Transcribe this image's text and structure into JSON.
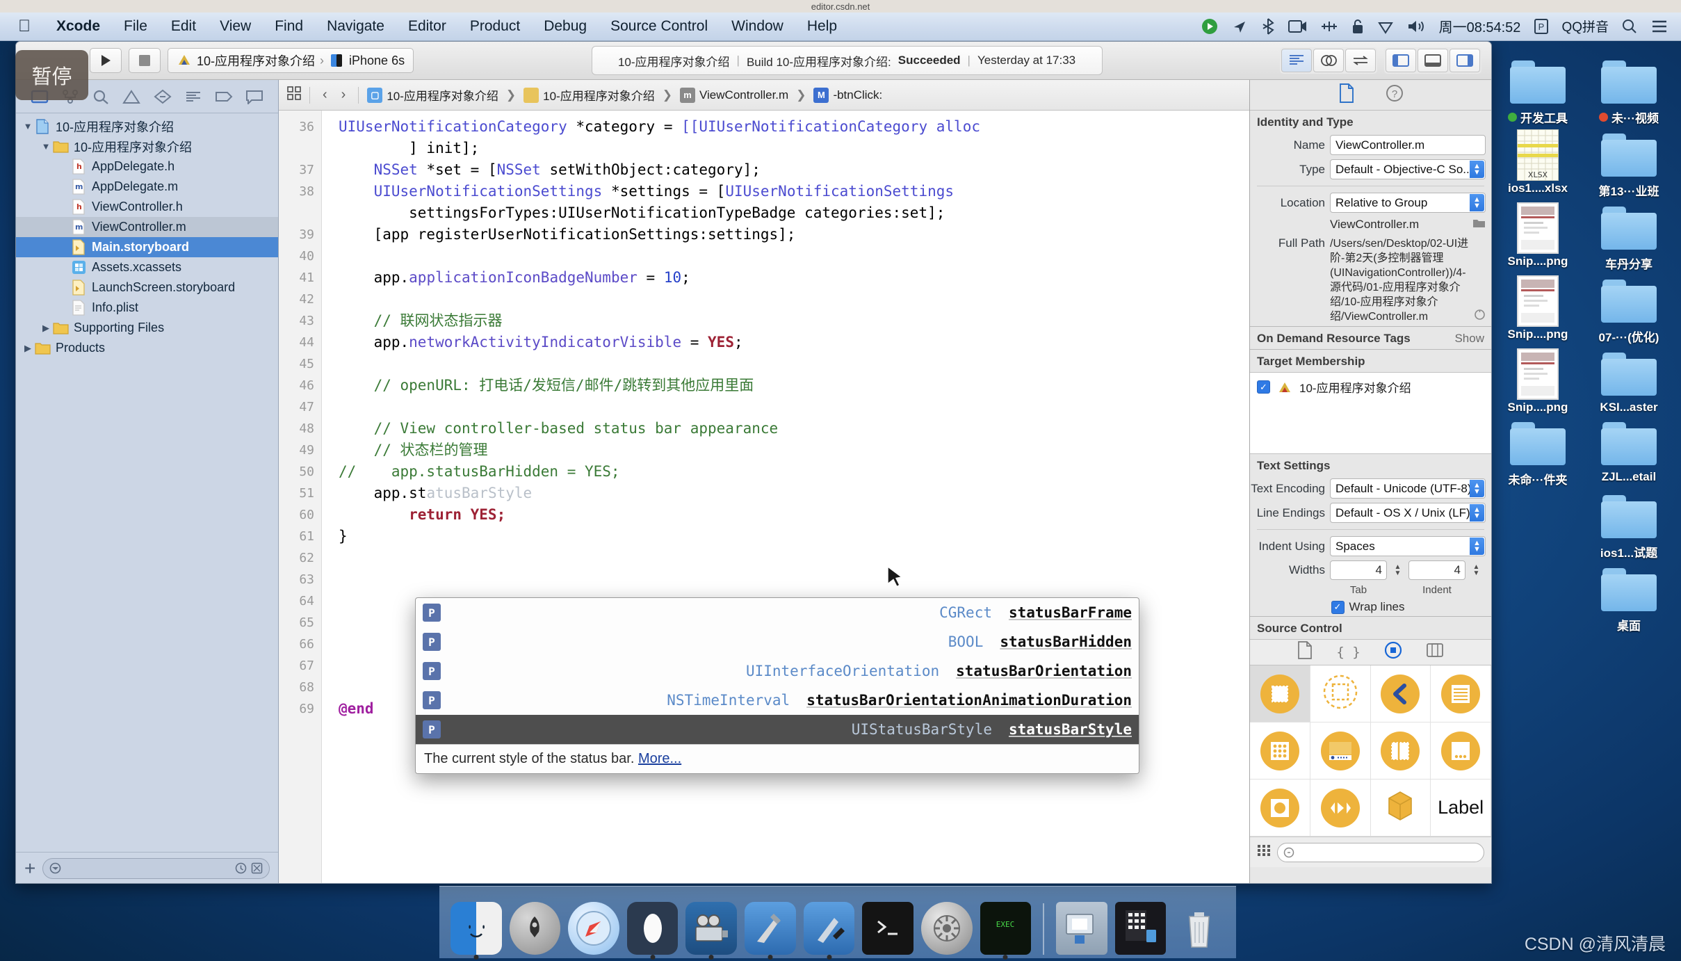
{
  "browser": {
    "url": "editor.csdn.net"
  },
  "menubar": {
    "apple_icon": "apple-logo-icon",
    "items": [
      "Xcode",
      "File",
      "Edit",
      "View",
      "Find",
      "Navigate",
      "Editor",
      "Product",
      "Debug",
      "Source Control",
      "Window",
      "Help"
    ],
    "status_items": [
      {
        "name": "screen-recorder-icon",
        "glyph": "▶"
      },
      {
        "name": "location-arrow-icon",
        "glyph": "➤"
      },
      {
        "name": "bluetooth-icon",
        "glyph": "✛"
      },
      {
        "name": "camera-icon",
        "glyph": "▣"
      },
      {
        "name": "audio-midi-icon",
        "glyph": "⬌"
      },
      {
        "name": "lock-icon",
        "glyph": "🔓"
      },
      {
        "name": "shield-icon",
        "glyph": "⬡"
      },
      {
        "name": "volume-icon",
        "glyph": "🔊"
      }
    ],
    "clock": "周一08:54:52",
    "input_method_badge": "P",
    "input_method": "QQ拼音",
    "search_icon": "search-icon",
    "notification_icon": "notification-center-icon"
  },
  "pause_overlay": {
    "label": "暂停"
  },
  "toolbar": {
    "run_icon": "play-icon",
    "stop_icon": "stop-icon",
    "scheme_name": "10-应用程序对象介绍",
    "scheme_chevron": "›",
    "destination": "iPhone 6s",
    "status": {
      "project": "10-应用程序对象介绍",
      "build_label": "Build 10-应用程序对象介绍:",
      "build_result": "Succeeded",
      "time": "Yesterday at 17:33"
    },
    "editor_modes": [
      {
        "name": "standard-editor-button",
        "active": true
      },
      {
        "name": "assistant-editor-button",
        "active": false
      },
      {
        "name": "version-editor-button",
        "active": false
      }
    ],
    "pane_toggles": [
      {
        "name": "navigator-toggle-button",
        "active": true
      },
      {
        "name": "debug-area-toggle-button",
        "active": false
      },
      {
        "name": "utilities-toggle-button",
        "active": true
      }
    ]
  },
  "navigator": {
    "tabs": [
      {
        "name": "project-navigator-tab",
        "active": true
      },
      {
        "name": "source-control-navigator-tab",
        "active": false
      },
      {
        "name": "symbol-navigator-tab",
        "active": false
      },
      {
        "name": "issue-navigator-tab",
        "active": false
      },
      {
        "name": "test-navigator-tab",
        "active": false
      },
      {
        "name": "debug-navigator-tab",
        "active": false
      },
      {
        "name": "breakpoint-navigator-tab",
        "active": false
      },
      {
        "name": "report-navigator-tab",
        "active": false
      }
    ],
    "tree": [
      {
        "label": "10-应用程序对象介绍",
        "depth": 0,
        "twisty": "▼",
        "icon": "project-icon",
        "state": "none"
      },
      {
        "label": "10-应用程序对象介绍",
        "depth": 1,
        "twisty": "▼",
        "icon": "folder-icon",
        "state": "none"
      },
      {
        "label": "AppDelegate.h",
        "depth": 2,
        "twisty": "",
        "icon": "h-file-icon",
        "state": "none"
      },
      {
        "label": "AppDelegate.m",
        "depth": 2,
        "twisty": "",
        "icon": "m-file-icon",
        "state": "none"
      },
      {
        "label": "ViewController.h",
        "depth": 2,
        "twisty": "",
        "icon": "h-file-icon",
        "state": "none"
      },
      {
        "label": "ViewController.m",
        "depth": 2,
        "twisty": "",
        "icon": "m-file-icon",
        "state": "softsel"
      },
      {
        "label": "Main.storyboard",
        "depth": 2,
        "twisty": "",
        "icon": "storyboard-icon",
        "state": "selected"
      },
      {
        "label": "Assets.xcassets",
        "depth": 2,
        "twisty": "",
        "icon": "assets-icon",
        "state": "none"
      },
      {
        "label": "LaunchScreen.storyboard",
        "depth": 2,
        "twisty": "",
        "icon": "storyboard-icon",
        "state": "none"
      },
      {
        "label": "Info.plist",
        "depth": 2,
        "twisty": "",
        "icon": "plist-icon",
        "state": "none"
      },
      {
        "label": "Supporting Files",
        "depth": 1,
        "twisty": "▶",
        "icon": "folder-icon",
        "state": "none"
      },
      {
        "label": "Products",
        "depth": 0,
        "twisty": "▶",
        "icon": "folder-icon",
        "state": "none"
      }
    ],
    "footer": {
      "add_icon": "add-icon",
      "filter_icon": "filter-icon",
      "filter_placeholder": "",
      "recent_icon": "recent-files-icon",
      "sourcectl_icon": "source-control-filter-icon"
    }
  },
  "jumpbar": {
    "related_icon": "related-items-icon",
    "back_icon": "back-chevron-icon",
    "forward_icon": "forward-chevron-icon",
    "crumbs": [
      {
        "label": "10-应用程序对象介绍",
        "icon": "project-icon"
      },
      {
        "label": "10-应用程序对象介绍",
        "icon": "folder-icon"
      },
      {
        "label": "ViewController.m",
        "icon": "m-file-icon"
      },
      {
        "label": "-btnClick:",
        "icon": "method-icon"
      }
    ]
  },
  "code": {
    "first_line_number": 36,
    "lines": [
      {
        "n": "36",
        "partial": true,
        "segments": [
          {
            "t": "UIUserNotificationCategory ",
            "c": "ty"
          },
          {
            "t": "*category",
            "c": "pl"
          },
          {
            "t": " = ",
            "c": "pl"
          },
          {
            "t": "[[UIUserNotificationCategory alloc",
            "c": "ty"
          }
        ]
      },
      {
        "n": "",
        "segments": [
          {
            "t": "        ] init];",
            "c": "pl"
          }
        ]
      },
      {
        "n": "37",
        "segments": [
          {
            "t": "    NSSet ",
            "c": "ty"
          },
          {
            "t": "*set = [",
            "c": "pl"
          },
          {
            "t": "NSSet",
            "c": "ty"
          },
          {
            "t": " setWithObject:category];",
            "c": "pl"
          }
        ]
      },
      {
        "n": "38",
        "segments": [
          {
            "t": "    UIUserNotificationSettings ",
            "c": "ty"
          },
          {
            "t": "*settings = [",
            "c": "pl"
          },
          {
            "t": "UIUserNotificationSettings",
            "c": "ty"
          }
        ]
      },
      {
        "n": "",
        "segments": [
          {
            "t": "        settingsForTypes:UIUserNotificationTypeBadge categories:set];",
            "c": "pl"
          }
        ]
      },
      {
        "n": "39",
        "segments": [
          {
            "t": "    [app registerUserNotificationSettings:settings];",
            "c": "pl"
          }
        ]
      },
      {
        "n": "40",
        "segments": [
          {
            "t": "",
            "c": "pl"
          }
        ]
      },
      {
        "n": "41",
        "segments": [
          {
            "t": "    app.",
            "c": "pl"
          },
          {
            "t": "applicationIconBadgeNumber",
            "c": "pr"
          },
          {
            "t": " = ",
            "c": "pl"
          },
          {
            "t": "10",
            "c": "nu"
          },
          {
            "t": ";",
            "c": "pl"
          }
        ]
      },
      {
        "n": "42",
        "segments": [
          {
            "t": "",
            "c": "pl"
          }
        ]
      },
      {
        "n": "43",
        "segments": [
          {
            "t": "    // 联网状态指示器",
            "c": "cm"
          }
        ]
      },
      {
        "n": "44",
        "segments": [
          {
            "t": "    app.",
            "c": "pl"
          },
          {
            "t": "networkActivityIndicatorVisible",
            "c": "pr"
          },
          {
            "t": " = ",
            "c": "pl"
          },
          {
            "t": "YES",
            "c": "yes"
          },
          {
            "t": ";",
            "c": "pl"
          }
        ]
      },
      {
        "n": "45",
        "segments": [
          {
            "t": "",
            "c": "pl"
          }
        ]
      },
      {
        "n": "46",
        "segments": [
          {
            "t": "    // openURL: 打电话/发短信/邮件/跳转到其他应用里面",
            "c": "cm"
          }
        ]
      },
      {
        "n": "47",
        "segments": [
          {
            "t": "",
            "c": "pl"
          }
        ]
      },
      {
        "n": "48",
        "segments": [
          {
            "t": "    // View controller-based status bar appearance",
            "c": "cm"
          }
        ]
      },
      {
        "n": "49",
        "segments": [
          {
            "t": "    // 状态栏的管理",
            "c": "cm"
          }
        ]
      },
      {
        "n": "50",
        "segments": [
          {
            "t": "//    app.statusBarHidden = YES;",
            "c": "cm"
          }
        ]
      },
      {
        "n": "51",
        "segments": [
          {
            "t": "    app.st",
            "c": "pl"
          },
          {
            "t": "atusBarStyle",
            "c": "ghost"
          }
        ]
      },
      {
        "n": "60",
        "hidden_behind_popup": true,
        "segments": [
          {
            "t": "        return YES;",
            "c": "yes"
          }
        ]
      },
      {
        "n": "61",
        "segments": [
          {
            "t": "}",
            "c": "pl"
          }
        ]
      },
      {
        "n": "62",
        "segments": [
          {
            "t": "",
            "c": "pl"
          }
        ]
      },
      {
        "n": "63",
        "segments": [
          {
            "t": "",
            "c": "pl"
          }
        ]
      },
      {
        "n": "64",
        "segments": [
          {
            "t": "",
            "c": "pl"
          }
        ]
      },
      {
        "n": "65",
        "segments": [
          {
            "t": "",
            "c": "pl"
          }
        ]
      },
      {
        "n": "66",
        "segments": [
          {
            "t": "",
            "c": "pl"
          }
        ]
      },
      {
        "n": "67",
        "segments": [
          {
            "t": "",
            "c": "pl"
          }
        ]
      },
      {
        "n": "68",
        "segments": [
          {
            "t": "",
            "c": "pl"
          }
        ]
      },
      {
        "n": "69",
        "segments": [
          {
            "t": "@end",
            "c": "k"
          }
        ]
      }
    ]
  },
  "autocomplete": {
    "items": [
      {
        "badge": "P",
        "type": "CGRect",
        "name": "statusBarFrame",
        "selected": false
      },
      {
        "badge": "P",
        "type": "BOOL",
        "name": "statusBarHidden",
        "selected": false
      },
      {
        "badge": "P",
        "type": "UIInterfaceOrientation",
        "name": "statusBarOrientation",
        "selected": false
      },
      {
        "badge": "P",
        "type": "NSTimeInterval",
        "name": "statusBarOrientationAnimationDuration",
        "selected": false
      },
      {
        "badge": "P",
        "type": "UIStatusBarStyle",
        "name": "statusBarStyle",
        "selected": true
      }
    ],
    "doc_text": "The current style of the status bar.",
    "doc_link": "More..."
  },
  "inspector": {
    "tabs": [
      {
        "name": "file-inspector-tab",
        "active": true
      },
      {
        "name": "quick-help-inspector-tab",
        "active": false
      }
    ],
    "identity_and_type": {
      "title": "Identity and Type",
      "name_label": "Name",
      "name_value": "ViewController.m",
      "type_label": "Type",
      "type_value": "Default - Objective-C So...",
      "location_label": "Location",
      "location_value": "Relative to Group",
      "location_file": "ViewController.m",
      "full_path_label": "Full Path",
      "full_path_value": "/Users/sen/Desktop/02-UI进阶-第2天(多控制器管理(UINavigationController))/4-源代码/01-应用程序对象介绍/10-应用程序对象介绍/ViewController.m"
    },
    "on_demand_resource_tags": {
      "title": "On Demand Resource Tags",
      "show_label": "Show"
    },
    "target_membership": {
      "title": "Target Membership",
      "target_name": "10-应用程序对象介绍",
      "checked": true
    },
    "text_settings": {
      "title": "Text Settings",
      "text_encoding_label": "Text Encoding",
      "text_encoding_value": "Default - Unicode (UTF-8)",
      "line_endings_label": "Line Endings",
      "line_endings_value": "Default - OS X / Unix (LF)",
      "indent_using_label": "Indent Using",
      "indent_using_value": "Spaces",
      "widths_label": "Widths",
      "tab_width": "4",
      "indent_width": "4",
      "tab_caption": "Tab",
      "indent_caption": "Indent",
      "wrap_lines_label": "Wrap lines",
      "wrap_lines_checked": true
    },
    "source_control": {
      "title": "Source Control"
    },
    "library": {
      "tabs": [
        {
          "name": "file-template-library-tab",
          "glyph": "🗋",
          "active": false
        },
        {
          "name": "code-snippet-library-tab",
          "glyph": "{ }",
          "active": false
        },
        {
          "name": "object-library-tab",
          "glyph": "◎",
          "active": true
        },
        {
          "name": "media-library-tab",
          "glyph": "🖼",
          "active": false
        }
      ],
      "objects": [
        {
          "name": "view-controller-object",
          "selected": true
        },
        {
          "name": "storyboard-reference-object",
          "selected": false
        },
        {
          "name": "navigation-controller-object",
          "selected": false
        },
        {
          "name": "table-view-controller-object",
          "selected": false
        },
        {
          "name": "collection-view-controller-object",
          "selected": false
        },
        {
          "name": "tab-bar-controller-object",
          "selected": false
        },
        {
          "name": "split-view-controller-object",
          "selected": false
        },
        {
          "name": "page-view-controller-object",
          "selected": false
        },
        {
          "name": "image-view-object",
          "selected": false
        },
        {
          "name": "avkit-player-controller-object",
          "selected": false
        },
        {
          "name": "glkit-view-controller-object",
          "selected": false
        },
        {
          "name": "label-object",
          "label": "Label",
          "selected": false
        }
      ],
      "footer": {
        "grid_icon": "grid-view-icon",
        "search_icon": "search-icon",
        "search_placeholder": ""
      }
    }
  },
  "desktop": {
    "icons": [
      {
        "label": "开发工具",
        "type": "folder",
        "dot": "#3fae3f"
      },
      {
        "label": "未···视频",
        "type": "folder",
        "dot": "#e04b2f"
      },
      {
        "label": "ios1....xlsx",
        "type": "xlsx"
      },
      {
        "label": "第13···业班",
        "type": "folder"
      },
      {
        "label": "Snip....png",
        "type": "png"
      },
      {
        "label": "车丹分享",
        "type": "folder"
      },
      {
        "label": "Snip....png",
        "type": "png"
      },
      {
        "label": "07-···(优化)",
        "type": "folder"
      },
      {
        "label": "Snip....png",
        "type": "png"
      },
      {
        "label": "KSI...aster",
        "type": "folder"
      },
      {
        "label": "未命···件夹",
        "type": "folder"
      },
      {
        "label": "ZJL...etail",
        "type": "folder"
      },
      {
        "label": "",
        "type": "none"
      },
      {
        "label": "ios1...试题",
        "type": "folder"
      },
      {
        "label": "",
        "type": "none"
      },
      {
        "label": "桌面",
        "type": "folder"
      }
    ]
  },
  "dock": {
    "items": [
      {
        "name": "finder-dock-icon",
        "running": true
      },
      {
        "name": "launchpad-dock-icon",
        "running": false
      },
      {
        "name": "safari-dock-icon",
        "running": false
      },
      {
        "name": "mouse-app-dock-icon",
        "running": true
      },
      {
        "name": "quicktime-dock-icon",
        "running": true
      },
      {
        "name": "xcode-dock-icon",
        "running": true
      },
      {
        "name": "xcode-beta-dock-icon",
        "running": true
      },
      {
        "name": "terminal-dock-icon",
        "running": false
      },
      {
        "name": "system-preferences-dock-icon",
        "running": false
      },
      {
        "name": "iterm-dock-icon",
        "running": true
      }
    ],
    "separator": true,
    "right_items": [
      {
        "name": "downloads-stack-dock-icon"
      },
      {
        "name": "documents-stack-dock-icon"
      },
      {
        "name": "trash-dock-icon"
      }
    ]
  },
  "watermark": {
    "text": "CSDN @清风清晨"
  }
}
